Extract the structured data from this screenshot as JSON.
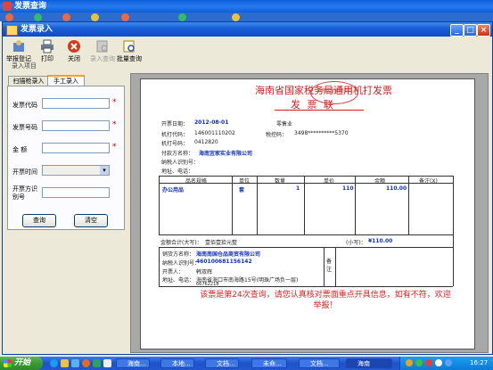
{
  "outer_window": {
    "title": "发票查询"
  },
  "window": {
    "title": "发票录入"
  },
  "toolbar": {
    "items": [
      {
        "label": "举报登记"
      },
      {
        "label": "打印"
      },
      {
        "label": "关闭"
      },
      {
        "label": "录入查询"
      },
      {
        "label": "批量查询"
      }
    ],
    "section_label": "录入项目"
  },
  "tabs": [
    {
      "label": "扫描枪录入"
    },
    {
      "label": "手工录入"
    }
  ],
  "form": {
    "fields": [
      {
        "label": "发票代码",
        "value": ""
      },
      {
        "label": "发票号码",
        "value": ""
      },
      {
        "label": "金    额",
        "value": ""
      },
      {
        "label": "开票时间",
        "value": ""
      },
      {
        "label": "开票方识别号",
        "value": ""
      }
    ],
    "required_mark": "*",
    "query_button": "查询",
    "clear_button": "清空"
  },
  "invoice": {
    "title": "海南省国家税务局通用机打发票",
    "seal_text": "海南省国家税务局",
    "subtitle": "发  票  联",
    "date_label": "开票日期：",
    "date_value": "2012-08-01",
    "industry": "零售业",
    "code_label": "机打代码：",
    "code_value": "146001110202",
    "tax_ctrl_label": "税控码：",
    "tax_ctrl_value": "3498**********5370",
    "number_label": "机打号码：",
    "number_value": "0412820",
    "payer_label": "付款方名称：",
    "payer_value": "海南宜家实业有限公司",
    "payer_id_label": "纳税人识别号：",
    "payer_addr_label": "地址、电话：",
    "columns": [
      "品名规格",
      "单位",
      "数量",
      "单价",
      "金额",
      "备注(X)"
    ],
    "rows": [
      {
        "name": "办公用品",
        "unit": "套",
        "qty": "1",
        "price": "110",
        "amount": "110.00"
      }
    ],
    "total_label": "金额合计(大写)：",
    "total_words": "壹佰壹拾元整",
    "total_small_label": "(小写)：",
    "total_small": "¥110.00",
    "seller_name_label": "销货方名称：",
    "seller_name": "海南南国仓品商贸有限公司",
    "seller_id_label": "纳税人识别号：",
    "seller_id": "460100681156142",
    "seller_person_label": "开票人：",
    "seller_person": "韩双辉",
    "seller_addr_label": "地址、电话：",
    "seller_addr": "海南省海口市南海路15号(明珠广场负一层)",
    "seller_phone": "66762218",
    "remark_label": "备注",
    "notice": "该票是第24次查询，请您认真核对票面重点开具信息，如有不符，欢迎举报！"
  },
  "taskbar": {
    "start": "开始",
    "items": [
      "海南...",
      "本地...",
      "文档...",
      "未命...",
      "文档...",
      "海南"
    ],
    "time": "16:27"
  }
}
